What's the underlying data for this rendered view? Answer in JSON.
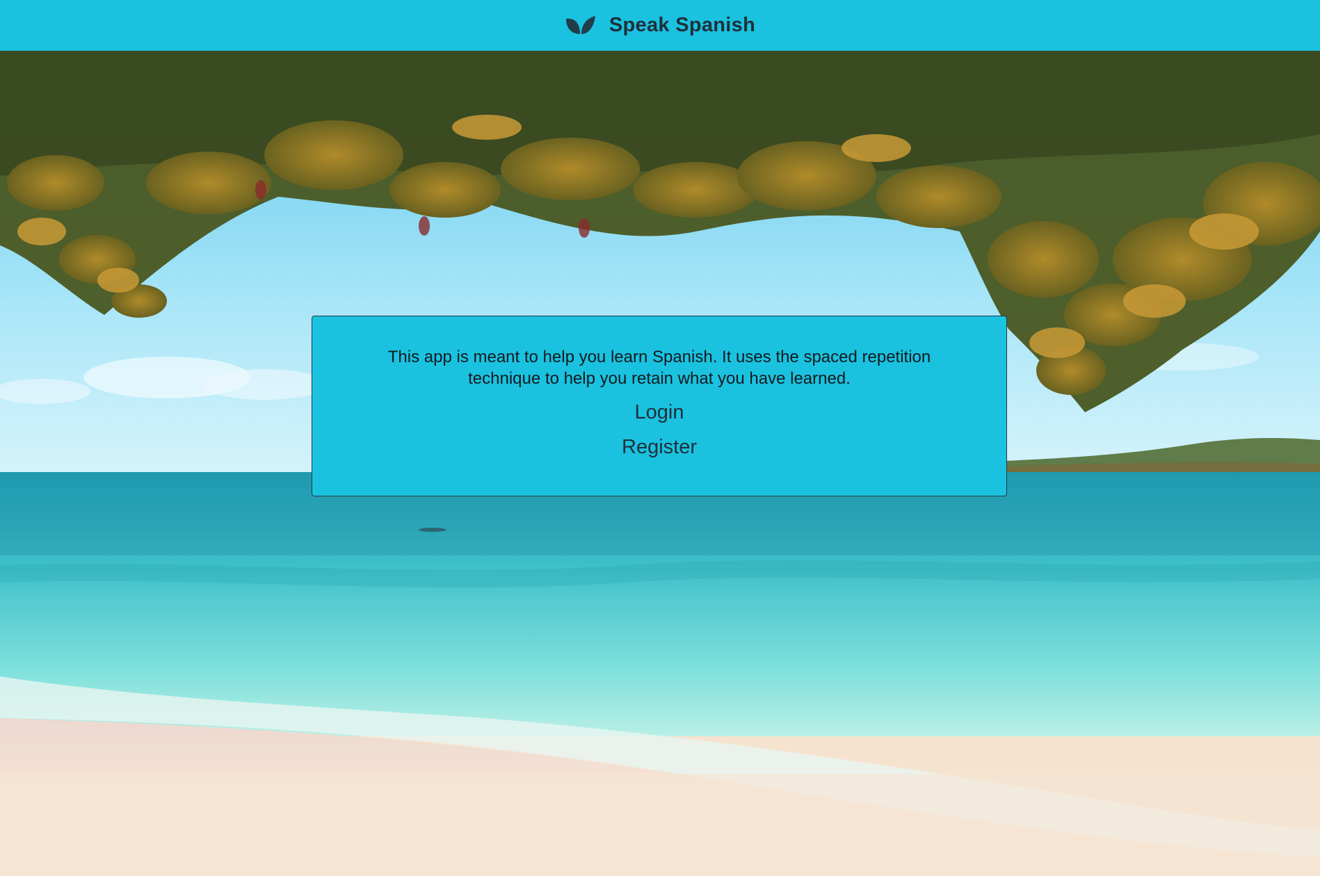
{
  "navbar": {
    "brand_icon": "leaves-icon",
    "title": "Speak Spanish",
    "background_color": "#1ac2e0"
  },
  "hero": {
    "image": "tropical-beach-with-tree-branches"
  },
  "card": {
    "intro_text": "This app is meant to help you learn Spanish. It uses the spaced repetition technique to help you retain what you have learned.",
    "login_label": "Login",
    "register_label": "Register",
    "background_color": "#1ac2e0"
  }
}
